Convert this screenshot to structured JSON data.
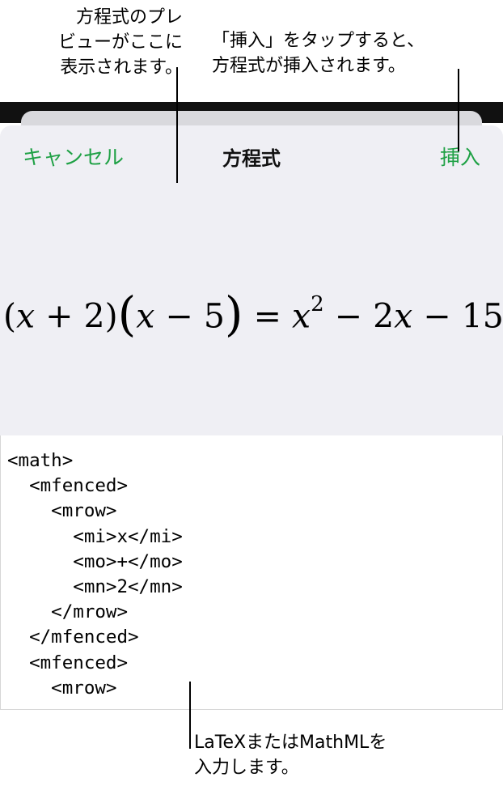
{
  "callouts": {
    "preview": "方程式のプレ\nビューがここに\n表示されます。",
    "insert": "「挿入」をタップすると、\n方程式が挿入されます。",
    "input": "LaTeXまたはMathMLを\n入力します。"
  },
  "header": {
    "cancel_label": "キャンセル",
    "title": "方程式",
    "insert_label": "挿入"
  },
  "equation": {
    "open1": "(",
    "x1": "x",
    "plus": " + ",
    "two": "2",
    "close1": ")",
    "open2": "(",
    "x2": "x",
    "minus": " − ",
    "five": "5",
    "close2": ")",
    "equals": " = ",
    "x3": "x",
    "exp": "2",
    "minus2": " − ",
    "twox_coef": "2",
    "x4": "x",
    "minus3": " − ",
    "fifteen": "15"
  },
  "editor": {
    "code": "<math>\n  <mfenced>\n    <mrow>\n      <mi>x</mi>\n      <mo>+</mo>\n      <mn>2</mn>\n    </mrow>\n  </mfenced>\n  <mfenced>\n    <mrow>"
  },
  "colors": {
    "accent": "#1fa145",
    "sheet_bg": "#efeff4"
  }
}
